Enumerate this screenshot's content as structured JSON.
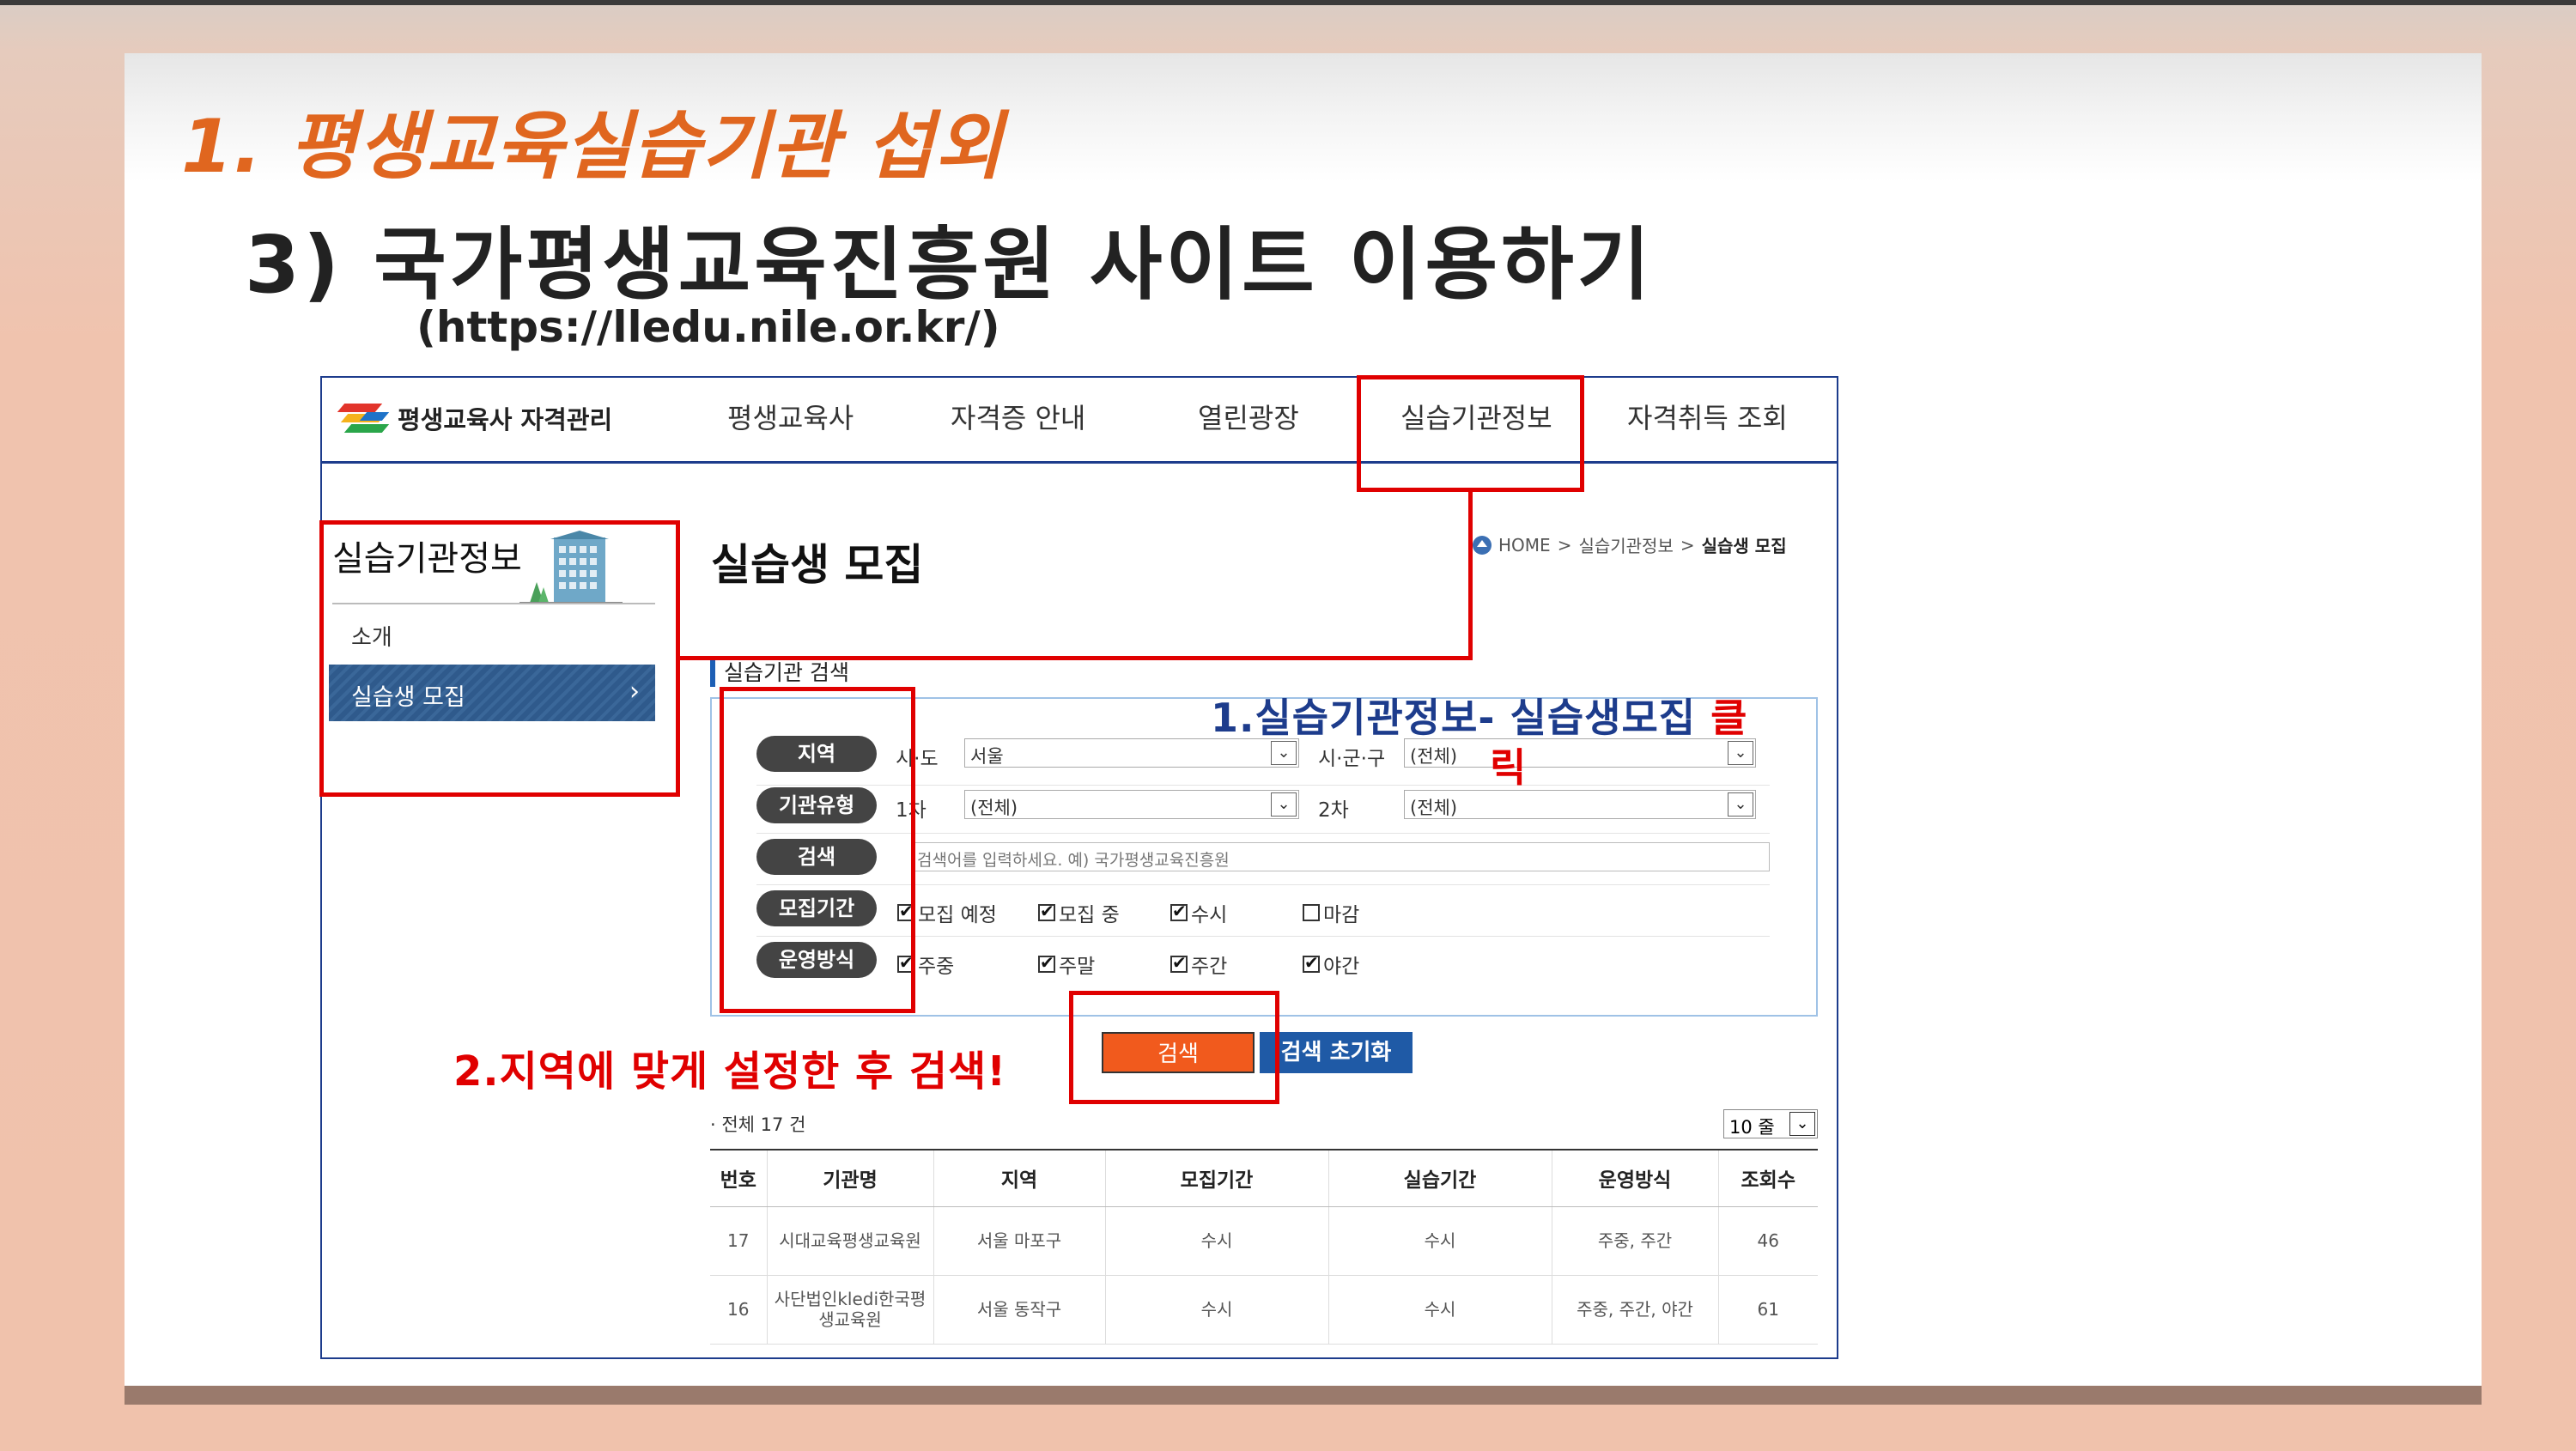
{
  "slide": {
    "main_title": "1. 평생교육실습기관 섭외",
    "sub_title": "3) 국가평생교육진흥원 사이트 이용하기",
    "url": "(https://lledu.nile.or.kr/)"
  },
  "site": {
    "logo_text": "평생교육사 자격관리",
    "nav": [
      "평생교육사",
      "자격증 안내",
      "열린광장",
      "실습기관정보",
      "자격취득 조회"
    ],
    "lnb_title": "실습기관정보",
    "lnb_items": [
      {
        "label": "소개"
      },
      {
        "label": "실습생 모집",
        "chevron": "›"
      }
    ],
    "page_title": "실습생 모집",
    "breadcrumb": {
      "home": "HOME",
      "sep": ">",
      "mid": "실습기관정보",
      "current": "실습생 모집"
    },
    "section_label": "실습기관 검색",
    "search": {
      "region_label": "지역",
      "sido_label": "시·도",
      "sido_value": "서울",
      "sigungu_label": "시·군·구",
      "sigungu_value": "(전체)",
      "type_label": "기관유형",
      "type1_label": "1차",
      "type1_value": "(전체)",
      "type2_label": "2차",
      "type2_value": "(전체)",
      "keyword_label": "검색",
      "keyword_placeholder": "검색어를 입력하세요. 예) 국가평생교육진흥원",
      "period_label": "모집기간",
      "period_options": [
        {
          "label": "모집 예정",
          "checked": true
        },
        {
          "label": "모집 중",
          "checked": true
        },
        {
          "label": "수시",
          "checked": true
        },
        {
          "label": "마감",
          "checked": false
        }
      ],
      "mode_label": "운영방식",
      "mode_options": [
        {
          "label": "주중",
          "checked": true
        },
        {
          "label": "주말",
          "checked": true
        },
        {
          "label": "주간",
          "checked": true
        },
        {
          "label": "야간",
          "checked": true
        }
      ],
      "search_button": "검색",
      "reset_button": "검색 초기화",
      "dropdown_arrow": "⌄"
    },
    "total_text": "· 전체 17 건",
    "rows_per_page": "10 줄",
    "table": {
      "headers": [
        "번호",
        "기관명",
        "지역",
        "모집기간",
        "실습기간",
        "운영방식",
        "조회수"
      ],
      "rows": [
        [
          "17",
          "시대교육평생교육원",
          "서울 마포구",
          "수시",
          "수시",
          "주중, 주간",
          "46"
        ],
        [
          "16",
          "사단법인kledi한국평생교육원",
          "서울 동작구",
          "수시",
          "수시",
          "주중, 주간, 야간",
          "61"
        ]
      ]
    }
  },
  "annotations": {
    "step1_prefix": "1.실습기관정보- 실습생모집 ",
    "step1_red1": "클",
    "step1_red2": "릭",
    "step2": "2.지역에 맞게 설정한 후 검색!"
  },
  "colors": {
    "title_orange": "#e0661f",
    "accent_red": "#e00000",
    "brand_blue": "#1d3c8c",
    "search_orange": "#f15a1d",
    "reset_blue": "#1f5aa6"
  }
}
